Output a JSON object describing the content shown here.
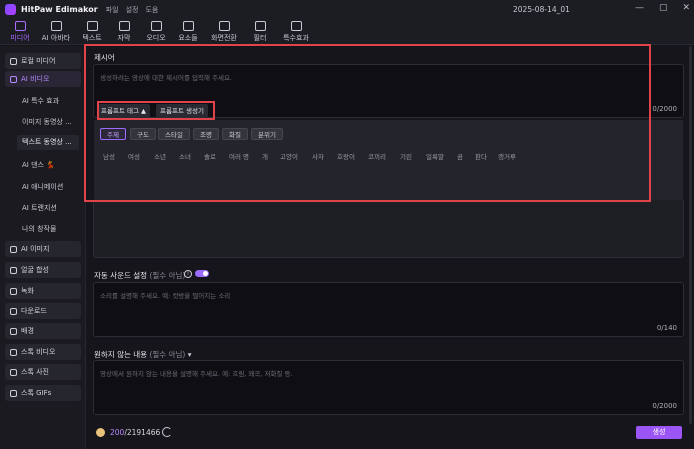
{
  "app": {
    "name": "HitPaw Edimakor",
    "menu": [
      "파일",
      "설정",
      "도움"
    ],
    "date": "2025-08-14_01"
  },
  "window_controls": [
    "—",
    "▢",
    "✕"
  ],
  "toolbar": [
    {
      "label": "미디어",
      "icon": "media-icon",
      "active": true
    },
    {
      "label": "AI 아바타",
      "icon": "avatar-icon"
    },
    {
      "label": "텍스트",
      "icon": "text-icon"
    },
    {
      "label": "자막",
      "icon": "subtitle-icon"
    },
    {
      "label": "오디오",
      "icon": "audio-icon"
    },
    {
      "label": "요소들",
      "icon": "elements-icon"
    },
    {
      "label": "화면전환",
      "icon": "transition-icon"
    },
    {
      "label": "필터",
      "icon": "filter-icon"
    },
    {
      "label": "특수효과",
      "icon": "effects-icon"
    }
  ],
  "sidebar": {
    "items": [
      {
        "label": "로컬 미디어"
      },
      {
        "label": "AI 비디오",
        "active": true
      },
      {
        "label": "AI 이미지"
      },
      {
        "label": "얼굴 합성"
      },
      {
        "label": "녹화"
      },
      {
        "label": "다운로드"
      },
      {
        "label": "배경"
      },
      {
        "label": "스톡 비디오"
      },
      {
        "label": "스톡 사진"
      },
      {
        "label": "스톡 GIFs"
      }
    ],
    "sub_items": [
      {
        "label": "AI 특수 효과"
      },
      {
        "label": "이미지 동영상 ..."
      },
      {
        "label": "텍스트 동영상 ...",
        "active": true
      },
      {
        "label": "AI 댄스 💃"
      },
      {
        "label": "AI 애니메이션"
      },
      {
        "label": "AI 트랜지션"
      },
      {
        "label": "나의 창작물"
      }
    ]
  },
  "prompt": {
    "label": "제시어",
    "placeholder": "생성하려는 영상에 대한 제시어를 입력해 주세요.",
    "counter": "0/2000",
    "tag_button": "프롬프트 태그 ▲",
    "generator_button": "프롬프트 생성기"
  },
  "tags": {
    "categories": [
      "주제",
      "구도",
      "스타일",
      "조명",
      "화질",
      "분위기"
    ],
    "items": [
      "남성",
      "여성",
      "소년",
      "소녀",
      "솔로",
      "여러 명",
      "개",
      "고양이",
      "사자",
      "호랑이",
      "코끼리",
      "기린",
      "얼룩말",
      "곰",
      "판다",
      "캥거루"
    ]
  },
  "sound": {
    "label": "자동 사운드 설정",
    "optional": "(필수 아님)",
    "toggle_on": true,
    "placeholder": "소리를 설명해 주세요. 예: 컷방울 떨어지는 소리",
    "counter": "0/140"
  },
  "negative": {
    "label": "원하지 않는 내용",
    "optional": "(필수 아님)",
    "placeholder": "영상에서 원하지 않는 내용을 설명해 주세요. 예: 흐림, 왜곡, 저화질 등.",
    "counter": "0/2000"
  },
  "footer": {
    "credits_used": "200",
    "credits_total": "/2191466",
    "generate": "생성"
  }
}
